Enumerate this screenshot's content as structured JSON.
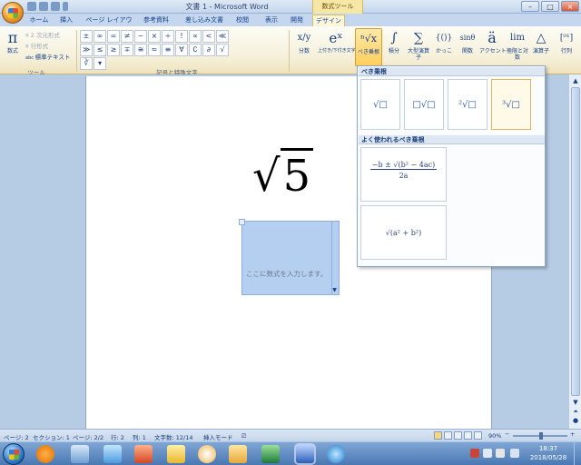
{
  "window": {
    "title": "文書 1 - Microsoft Word",
    "context_tab_group": "数式ツール"
  },
  "tabs": [
    "ホーム",
    "挿入",
    "ページ レイアウト",
    "参考資料",
    "差し込み文書",
    "校閲",
    "表示",
    "開発",
    "デザイン"
  ],
  "ribbon": {
    "tools": {
      "equation_label": "数式",
      "professional": "2 次元形式",
      "linear": "行形式",
      "normal_text": "標準テキスト",
      "group_label": "ツール"
    },
    "symbols": {
      "items": [
        "±",
        "∞",
        "=",
        "≠",
        "~",
        "×",
        "÷",
        "!",
        "∝",
        "<",
        "≪",
        "≫",
        "≤",
        "≥",
        "∓",
        "≅",
        "≈",
        "≡",
        "∀",
        "∁",
        "∂",
        "√",
        "∛"
      ],
      "group_label": "記号と特殊文字"
    },
    "structures": [
      {
        "icon": "x/y",
        "label": "分数"
      },
      {
        "icon": "eˣ",
        "label": "上付き/下付き文字"
      },
      {
        "icon": "ⁿ√x",
        "label": "べき乗根"
      },
      {
        "icon": "∫",
        "label": "積分"
      },
      {
        "icon": "∑",
        "label": "大型演算子"
      },
      {
        "icon": "{()}",
        "label": "かっこ"
      },
      {
        "icon": "sinθ",
        "label": "関数"
      },
      {
        "icon": "ä",
        "label": "アクセント"
      },
      {
        "icon": "lim",
        "label": "極限と対数"
      },
      {
        "icon": "△",
        "label": "演算子"
      },
      {
        "icon": "[⁰¹]",
        "label": "行列"
      }
    ]
  },
  "document": {
    "math_expr": "5",
    "equation_placeholder": "ここに数式を入力します。"
  },
  "dropdown": {
    "section1_title": "べき乗根",
    "radical_options": [
      "√□",
      "□√□",
      "²√□",
      "³√□"
    ],
    "section2_title": "よく使われるべき乗根",
    "formula1_numerator": "−b ± √(b² − 4ac)",
    "formula1_denominator": "2a",
    "formula2": "√(a² + b²)"
  },
  "status": {
    "page": "ページ: 2",
    "section": "セクション: 1",
    "pages": "ページ: 2/2",
    "line": "行: 2",
    "column": "列: 1",
    "word_count": "文字数: 12/14",
    "mode": "挿入モード",
    "zoom": "90%"
  },
  "taskbar": {
    "time": "18:37",
    "date": "2018/05/28"
  }
}
